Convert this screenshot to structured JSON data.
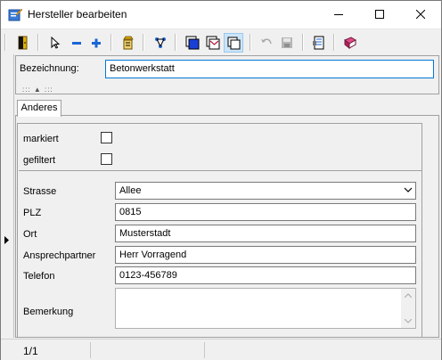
{
  "window": {
    "title": "Hersteller  bearbeiten",
    "app_icon": "edit-pencil-icon",
    "controls": [
      "minimize-icon",
      "maximize-icon",
      "close-icon"
    ]
  },
  "toolbar": {
    "buttons": [
      {
        "name": "exit-door-icon"
      },
      {
        "name": "select-arrow-icon"
      },
      {
        "name": "remove-minus-icon"
      },
      {
        "name": "add-plus-icon"
      },
      {
        "name": "properties-icon"
      },
      {
        "name": "filter-tree-icon"
      },
      {
        "name": "window-blue-icon"
      },
      {
        "name": "window-mail-icon"
      },
      {
        "name": "window-stack-icon",
        "active": true
      },
      {
        "name": "undo-icon",
        "disabled": true
      },
      {
        "name": "save-disk-icon",
        "disabled": true
      },
      {
        "name": "report-icon"
      },
      {
        "name": "book-icon"
      }
    ]
  },
  "header": {
    "bezeichnung_label": "Bezeichnung:",
    "bezeichnung_value": "Betonwerkstatt",
    "splitter": "::: ▲ :::"
  },
  "tabs": [
    {
      "label": "Anderes",
      "selected": true
    }
  ],
  "form": {
    "markiert_label": "markiert",
    "markiert_checked": false,
    "gefiltert_label": "gefiltert",
    "gefiltert_checked": false,
    "strasse_label": "Strasse",
    "strasse_value": "Allee",
    "plz_label": "PLZ",
    "plz_value": "0815",
    "ort_label": "Ort",
    "ort_value": "Musterstadt",
    "ansprechpartner_label": "Ansprechpartner",
    "ansprechpartner_value": "Herr Vorragend",
    "telefon_label": "Telefon",
    "telefon_value": "0123-456789",
    "bemerkung_label": "Bemerkung",
    "bemerkung_value": ""
  },
  "status": {
    "record": "1/1"
  }
}
